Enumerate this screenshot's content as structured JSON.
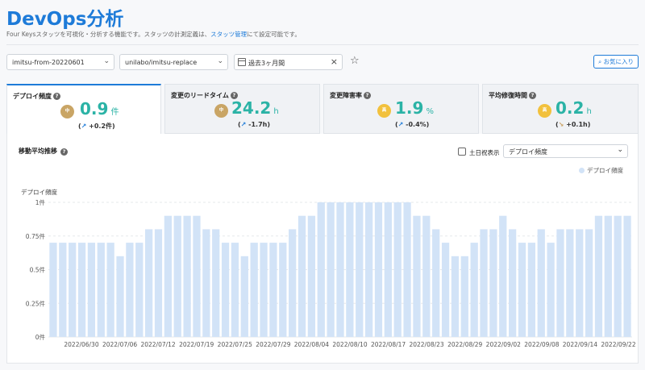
{
  "page": {
    "title": "DevOps分析",
    "subtitle_before": "Four Keysスタッツを可視化・分析する機能です。スタッツの計測定義は、",
    "subtitle_link": "スタッツ管理",
    "subtitle_after": "にて設定可能です。"
  },
  "filters": {
    "team": "imitsu-from-20220601",
    "repository": "unilabo/imitsu-replace",
    "period": "過去3ヶ月間",
    "clear_icon": "close-icon",
    "favorite_star_icon": "star-icon",
    "favorite_button": "お気に入り"
  },
  "cards": [
    {
      "title": "デプロイ頻度",
      "badge": "Medium",
      "badge_text": "中",
      "value": "0.9",
      "unit": "件",
      "delta_arrow": "↗",
      "delta": "+0.2件"
    },
    {
      "title": "変更のリードタイム",
      "badge": "Medium",
      "badge_text": "中",
      "value": "24.2",
      "unit": "h",
      "delta_arrow": "↗",
      "delta": "-1.7h"
    },
    {
      "title": "変更障害率",
      "badge": "High",
      "badge_text": "高",
      "value": "1.9",
      "unit": "%",
      "delta_arrow": "↗",
      "delta": "-0.4%"
    },
    {
      "title": "平均修復時間",
      "badge": "High",
      "badge_text": "高",
      "value": "0.2",
      "unit": "h",
      "delta_arrow": "↘",
      "delta": "+0.1h"
    }
  ],
  "panel": {
    "title": "移動平均推移",
    "weekend_checkbox_label": "土日祝表示",
    "weekend_checked": false,
    "metric_select": "デプロイ頻度",
    "legend_label": "デプロイ頻度"
  },
  "chart_data": {
    "type": "bar",
    "ylabel": "デプロイ頻度",
    "ylim": [
      0,
      1
    ],
    "y_ticks": [
      "0件",
      "0.25件",
      "0.5件",
      "0.75件",
      "1件"
    ],
    "y_tick_values": [
      0,
      0.25,
      0.5,
      0.75,
      1
    ],
    "x_tick_labels": [
      "2022/06/30",
      "2022/07/06",
      "2022/07/12",
      "2022/07/19",
      "2022/07/25",
      "2022/07/29",
      "2022/08/04",
      "2022/08/10",
      "2022/08/17",
      "2022/08/23",
      "2022/08/29",
      "2022/09/02",
      "2022/09/08",
      "2022/09/14",
      "2022/09/22"
    ],
    "series": [
      {
        "name": "デプロイ頻度",
        "color": "#d2e3f7",
        "values": [
          0.7,
          0.7,
          0.7,
          0.7,
          0.7,
          0.7,
          0.7,
          0.6,
          0.7,
          0.7,
          0.8,
          0.8,
          0.9,
          0.9,
          0.9,
          0.9,
          0.8,
          0.8,
          0.7,
          0.7,
          0.6,
          0.7,
          0.7,
          0.7,
          0.7,
          0.8,
          0.9,
          0.9,
          1,
          1,
          1,
          1,
          1,
          1,
          1,
          1,
          1,
          1,
          0.9,
          0.9,
          0.8,
          0.7,
          0.6,
          0.6,
          0.7,
          0.8,
          0.8,
          0.9,
          0.8,
          0.7,
          0.7,
          0.8,
          0.7,
          0.8,
          0.8,
          0.8,
          0.8,
          0.9,
          0.9,
          0.9,
          0.9
        ]
      }
    ]
  }
}
